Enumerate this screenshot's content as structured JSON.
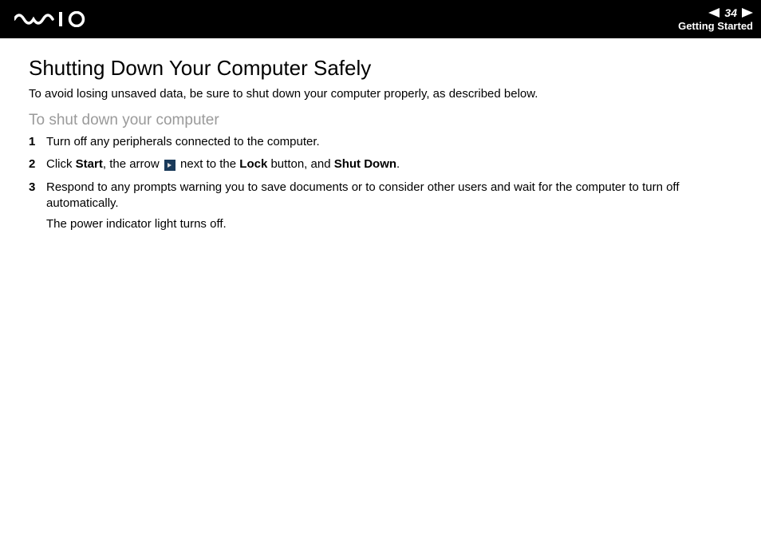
{
  "header": {
    "page_number": "34",
    "section": "Getting Started"
  },
  "title": "Shutting Down Your Computer Safely",
  "intro": "To avoid losing unsaved data, be sure to shut down your computer properly, as described below.",
  "subtitle": "To shut down your computer",
  "steps": {
    "s1": "Turn off any peripherals connected to the computer.",
    "s2_a": "Click ",
    "s2_b": "Start",
    "s2_c": ", the arrow ",
    "s2_d": " next to the ",
    "s2_e": "Lock",
    "s2_f": " button, and ",
    "s2_g": "Shut Down",
    "s2_h": ".",
    "s3_a": "Respond to any prompts warning you to save documents or to consider other users and wait for the computer to turn off automatically.",
    "s3_b": "The power indicator light turns off."
  }
}
